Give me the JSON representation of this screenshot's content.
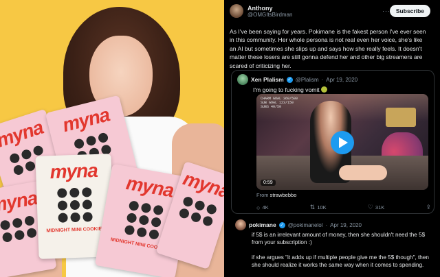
{
  "tweet": {
    "author_name": "Anthony",
    "author_handle": "@OMGItsBirdman",
    "subscribe_label": "Subscribe",
    "more_label": "···",
    "body": "As I've been saying for years. Pokimane is the fakest person I've ever seen in this community. Her whole persona is not real even her voice, she's like an AI but sometimes she slips up and says how she really feels. It doesn't matter these losers are still gonna defend her and other big streamers are scared of criticizing her."
  },
  "quoted": {
    "author_name": "Xen Plalism",
    "author_handle": "@Plalism",
    "date": "Apr 19, 2020",
    "text": "I'm going to fucking vomit",
    "video_duration": "0:59",
    "video_overlay": "CHARM GOAL 360/500\nSUB GOAL 123/150\nSUBS 40/50",
    "from_label": "From",
    "from_source": "strawbebbo",
    "actions": {
      "replies": "4K",
      "retweets": "10K",
      "likes": "31K"
    }
  },
  "reply": {
    "author_name": "pokimane",
    "author_handle": "@pokimanelol",
    "date": "Apr 19, 2020",
    "paragraph1": "if 5$ is an irrelevant amount of money, then she shouldn't need the 5$ from your subscription :)",
    "paragraph2": "if she argues \"it adds up if multiple people give me the 5$ though\", then she should realize it works the same way when it comes to spending."
  },
  "photo": {
    "bag_brand": "myna",
    "bag_band": "MIDNIGHT MINI COOKIES"
  },
  "colors": {
    "background_left": "#f7c844",
    "accent_blue": "#1d9bf0",
    "brand_red": "#e2372e"
  }
}
